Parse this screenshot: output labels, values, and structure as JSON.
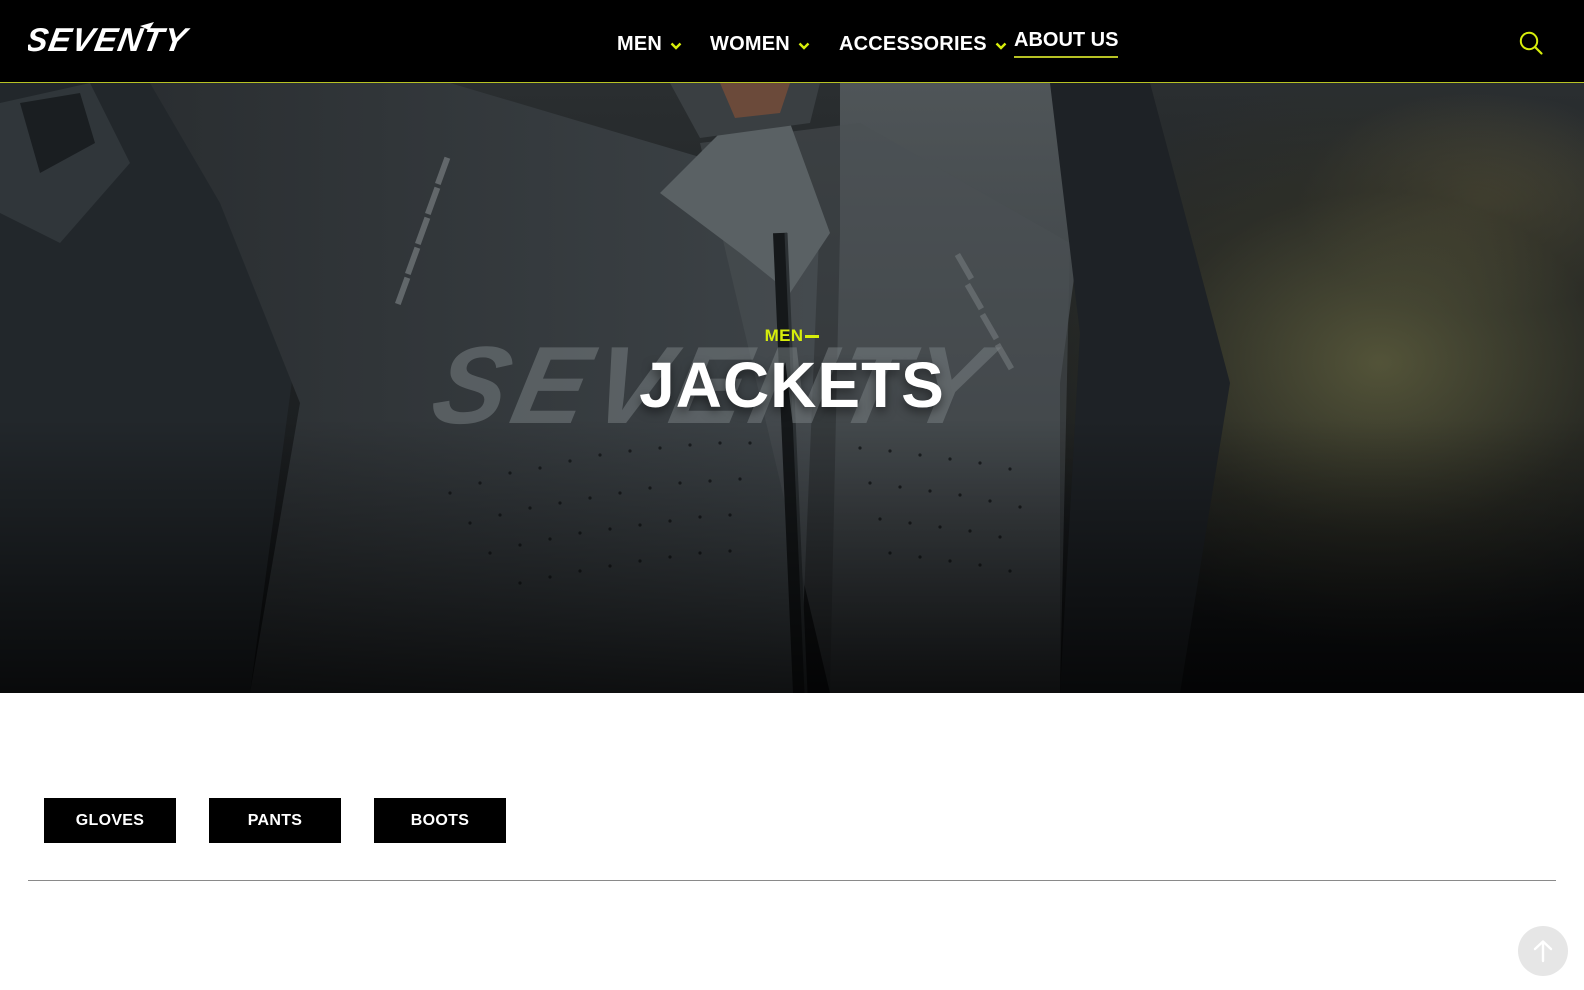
{
  "header": {
    "logo_text": "SEVENTY",
    "nav": [
      {
        "label": "MEN",
        "has_dropdown": true
      },
      {
        "label": "WOMEN",
        "has_dropdown": true
      },
      {
        "label": "ACCESSORIES",
        "has_dropdown": true
      },
      {
        "label": "ABOUT US",
        "has_dropdown": false
      }
    ],
    "search_icon": "search-icon",
    "accent_color": "#b7c224"
  },
  "hero": {
    "breadcrumb": "MEN",
    "title": "JACKETS",
    "breadcrumb_color": "#d7ee0b"
  },
  "categories": [
    {
      "label": "GLOVES"
    },
    {
      "label": "PANTS"
    },
    {
      "label": "BOOTS"
    }
  ],
  "scroll_top_icon": "arrow-up-icon"
}
